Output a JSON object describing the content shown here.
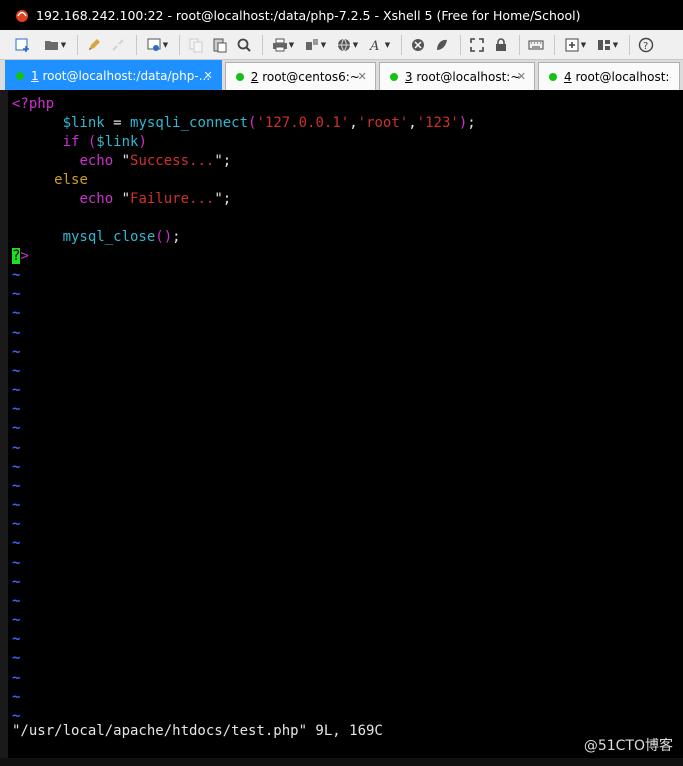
{
  "window": {
    "title": "192.168.242.100:22 - root@localhost:/data/php-7.2.5 - Xshell 5 (Free for Home/School)"
  },
  "toolbar": {
    "icons": [
      "new-session-icon",
      "open-folder-icon",
      "pen-icon",
      "disconnect-icon",
      "properties-icon",
      "copy-icon",
      "paste-icon",
      "find-icon",
      "print-icon",
      "transfer-icon",
      "globe-icon",
      "font-icon",
      "xftp-icon",
      "xmanager-icon",
      "fullscreen-icon",
      "lock-icon",
      "keyboard-icon",
      "add-pane-icon",
      "layout-icon",
      "help-icon"
    ]
  },
  "tabs": [
    {
      "num": "1",
      "label": " root@localhost:/data/php-...",
      "active": true
    },
    {
      "num": "2",
      "label": " root@centos6:~",
      "active": false
    },
    {
      "num": "3",
      "label": " root@localhost:~",
      "active": false
    },
    {
      "num": "4",
      "label": " root@localhost:~",
      "active": false
    }
  ],
  "code": {
    "l1": "<?php",
    "l2_var": "$link",
    "l2_eq": " = ",
    "l2_fn": "mysqli_connect",
    "l2_paren_open": "(",
    "l2_s1": "'127.0.0.1'",
    "l2_comma1": ",",
    "l2_s2": "'root'",
    "l2_comma2": ",",
    "l2_s3": "'123'",
    "l2_paren_close": ")",
    "l2_semi": ";",
    "l3_if": "if",
    "l3_open": " (",
    "l3_var": "$link",
    "l3_close": ")",
    "l4_echo": "echo",
    "l4_q1": " \"",
    "l4_str": "Success...",
    "l4_q2": "\";",
    "l5_else": "else",
    "l6_echo": "echo",
    "l6_q1": " \"",
    "l6_str": "Failure...",
    "l6_q2": "\";",
    "l8_fn": "mysql_close",
    "l8_parens": "()",
    "l8_semi": ";",
    "l9_cursor": "?",
    "l9_rest": ">",
    "tilde": "~"
  },
  "status_line": "\"/usr/local/apache/htdocs/test.php\" 9L, 169C",
  "watermark": "@51CTO博客"
}
